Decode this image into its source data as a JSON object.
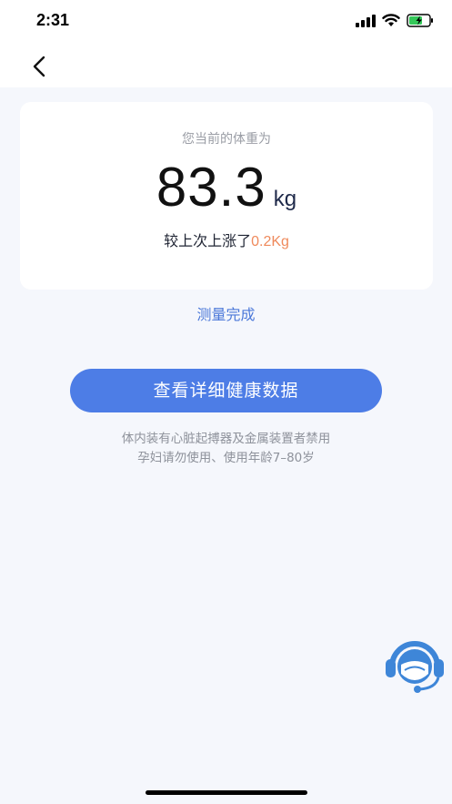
{
  "status_bar": {
    "time": "2:31"
  },
  "weight_card": {
    "title": "您当前的体重为",
    "value": "83.3",
    "unit": "kg",
    "compare_prefix": "较上次上涨了",
    "compare_change": "0.2Kg"
  },
  "status_text": "测量完成",
  "detail_button_label": "查看详细健康数据",
  "notice_lines": [
    "体内装有心脏起搏器及金属装置者禁用",
    "孕妇请勿使用、使用年龄7–80岁"
  ],
  "colors": {
    "accent": "#4d7de6",
    "status_link": "#4b78d9",
    "increase": "#ef8a5c",
    "background": "#f5f7fc"
  },
  "icons": {
    "back": "chevron-left-icon",
    "signal": "signal-icon",
    "wifi": "wifi-icon",
    "battery": "battery-charging-icon",
    "support": "customer-service-icon"
  }
}
